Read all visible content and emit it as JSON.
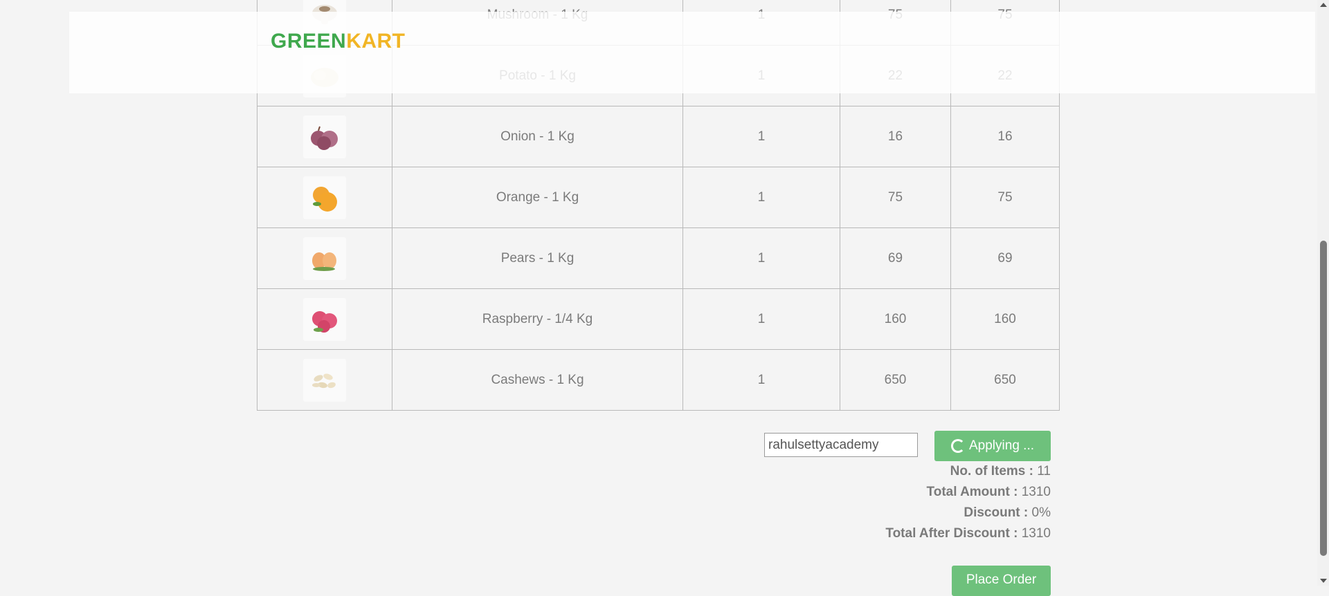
{
  "header": {
    "logo_green": "GREEN",
    "logo_kart": "KART"
  },
  "cart": {
    "rows": [
      {
        "product": "Mushroom - 1 Kg",
        "quantity": "1",
        "price": "75",
        "total": "75",
        "image_icon": "mushroom-image"
      },
      {
        "product": "Potato - 1 Kg",
        "quantity": "1",
        "price": "22",
        "total": "22",
        "image_icon": "potato-image"
      },
      {
        "product": "Onion - 1 Kg",
        "quantity": "1",
        "price": "16",
        "total": "16",
        "image_icon": "onion-image"
      },
      {
        "product": "Orange - 1 Kg",
        "quantity": "1",
        "price": "75",
        "total": "75",
        "image_icon": "orange-image"
      },
      {
        "product": "Pears - 1 Kg",
        "quantity": "1",
        "price": "69",
        "total": "69",
        "image_icon": "pears-image"
      },
      {
        "product": "Raspberry - 1/4 Kg",
        "quantity": "1",
        "price": "160",
        "total": "160",
        "image_icon": "raspberry-image"
      },
      {
        "product": "Cashews - 1 Kg",
        "quantity": "1",
        "price": "650",
        "total": "650",
        "image_icon": "cashews-image"
      }
    ]
  },
  "promo": {
    "code_value": "rahulsettyacademy",
    "apply_label": "Applying ..."
  },
  "summary": {
    "items_label": "No. of Items :",
    "items_value": "11",
    "amount_label": "Total Amount :",
    "amount_value": "1310",
    "discount_label": "Discount :",
    "discount_value": "0%",
    "after_label": "Total After Discount :",
    "after_value": "1310"
  },
  "place_order_label": "Place Order",
  "colors": {
    "brand_green": "#1e9a2f",
    "brand_orange": "#f0a900",
    "button_green": "#6ec17c"
  }
}
